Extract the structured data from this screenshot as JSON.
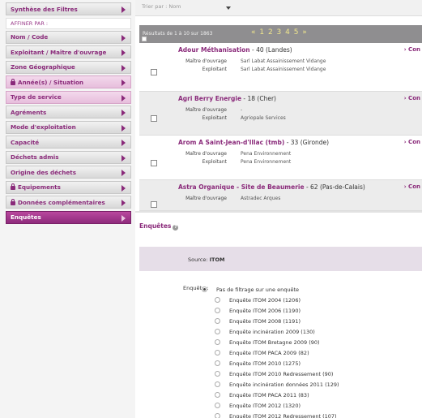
{
  "sidebar": {
    "items": [
      {
        "label": "Synthèse des Filtres",
        "style": "normal",
        "locked": false
      },
      {
        "label": "AFFINER PAR :",
        "style": "heading",
        "locked": false
      },
      {
        "label": "Nom / Code",
        "style": "normal",
        "locked": false
      },
      {
        "label": "Exploitant / Maître d'ouvrage",
        "style": "normal",
        "locked": false
      },
      {
        "label": "Zone Géographique",
        "style": "normal",
        "locked": false
      },
      {
        "label": "Année(s) / Situation",
        "style": "pink",
        "locked": true
      },
      {
        "label": "Type de service",
        "style": "pink",
        "locked": false
      },
      {
        "label": "Agréments",
        "style": "normal",
        "locked": false
      },
      {
        "label": "Mode d'exploitation",
        "style": "normal",
        "locked": false
      },
      {
        "label": "Capacité",
        "style": "normal",
        "locked": false
      },
      {
        "label": "Déchets admis",
        "style": "normal",
        "locked": false
      },
      {
        "label": "Origine des déchets",
        "style": "normal",
        "locked": false
      },
      {
        "label": "Equipements",
        "style": "normal",
        "locked": true
      },
      {
        "label": "Données complémentaires",
        "style": "normal",
        "locked": true
      },
      {
        "label": "Enquêtes",
        "style": "active",
        "locked": false
      }
    ]
  },
  "results": {
    "sort_label": "Trier par : Nom",
    "info": "Résultats de 1 à 10 sur 1863",
    "pages": "«  1  2  3  4  5  »",
    "items": [
      {
        "name": "Adour Méthanisation",
        "rest": " - 40 (Landes)",
        "link": "› Con",
        "rows": [
          {
            "label": "Maître d'ouvrage",
            "value": "Sarl Labat Assainissement Vidange"
          },
          {
            "label": "Exploitant",
            "value": "Sarl Labat Assainissement Vidange"
          }
        ]
      },
      {
        "name": "Agri Berry Energie",
        "rest": " - 18 (Cher)",
        "link": "› Con",
        "rows": [
          {
            "label": "Maître d'ouvrage",
            "value": "-"
          },
          {
            "label": "Exploitant",
            "value": "Agriopale Services"
          }
        ]
      },
      {
        "name": "Arom A Saint-Jean-d'Illac (tmb)",
        "rest": " - 33 (Gironde)",
        "link": "› Con",
        "rows": [
          {
            "label": "Maître d'ouvrage",
            "value": "Pena Environnement"
          },
          {
            "label": "Exploitant",
            "value": "Pena Environnement"
          }
        ]
      },
      {
        "name": "Astra Organique - Site de Beaumerie",
        "rest": " - 62 (Pas-de-Calais)",
        "link": "› Con",
        "rows": [
          {
            "label": "Maître d'ouvrage",
            "value": "Astradec Arques"
          }
        ]
      }
    ]
  },
  "enquetes": {
    "title": "Enquêtes",
    "help_glyph": "?",
    "source_prefix": "Source:",
    "source_value": "ITOM",
    "label": "Enquête :",
    "options": [
      {
        "label": "Pas de filtrage sur une enquête",
        "checked": true
      },
      {
        "label": "Enquête ITOM 2004 (1206)",
        "checked": false
      },
      {
        "label": "Enquête ITOM 2006 (1190)",
        "checked": false
      },
      {
        "label": "Enquête ITOM 2008 (1191)",
        "checked": false
      },
      {
        "label": "Enquête incinération 2009 (130)",
        "checked": false
      },
      {
        "label": "Enquête ITOM Bretagne 2009 (90)",
        "checked": false
      },
      {
        "label": "Enquête ITOM PACA 2009 (82)",
        "checked": false
      },
      {
        "label": "Enquête ITOM 2010 (1275)",
        "checked": false
      },
      {
        "label": "Enquête ITOM 2010 Redressement (90)",
        "checked": false
      },
      {
        "label": "Enquête incinération données 2011 (129)",
        "checked": false
      },
      {
        "label": "Enquête ITOM PACA 2011 (83)",
        "checked": false
      },
      {
        "label": "Enquête ITOM 2012 (1320)",
        "checked": false
      },
      {
        "label": "Enquête ITOM 2012 Redressement (107)",
        "checked": false
      }
    ]
  }
}
